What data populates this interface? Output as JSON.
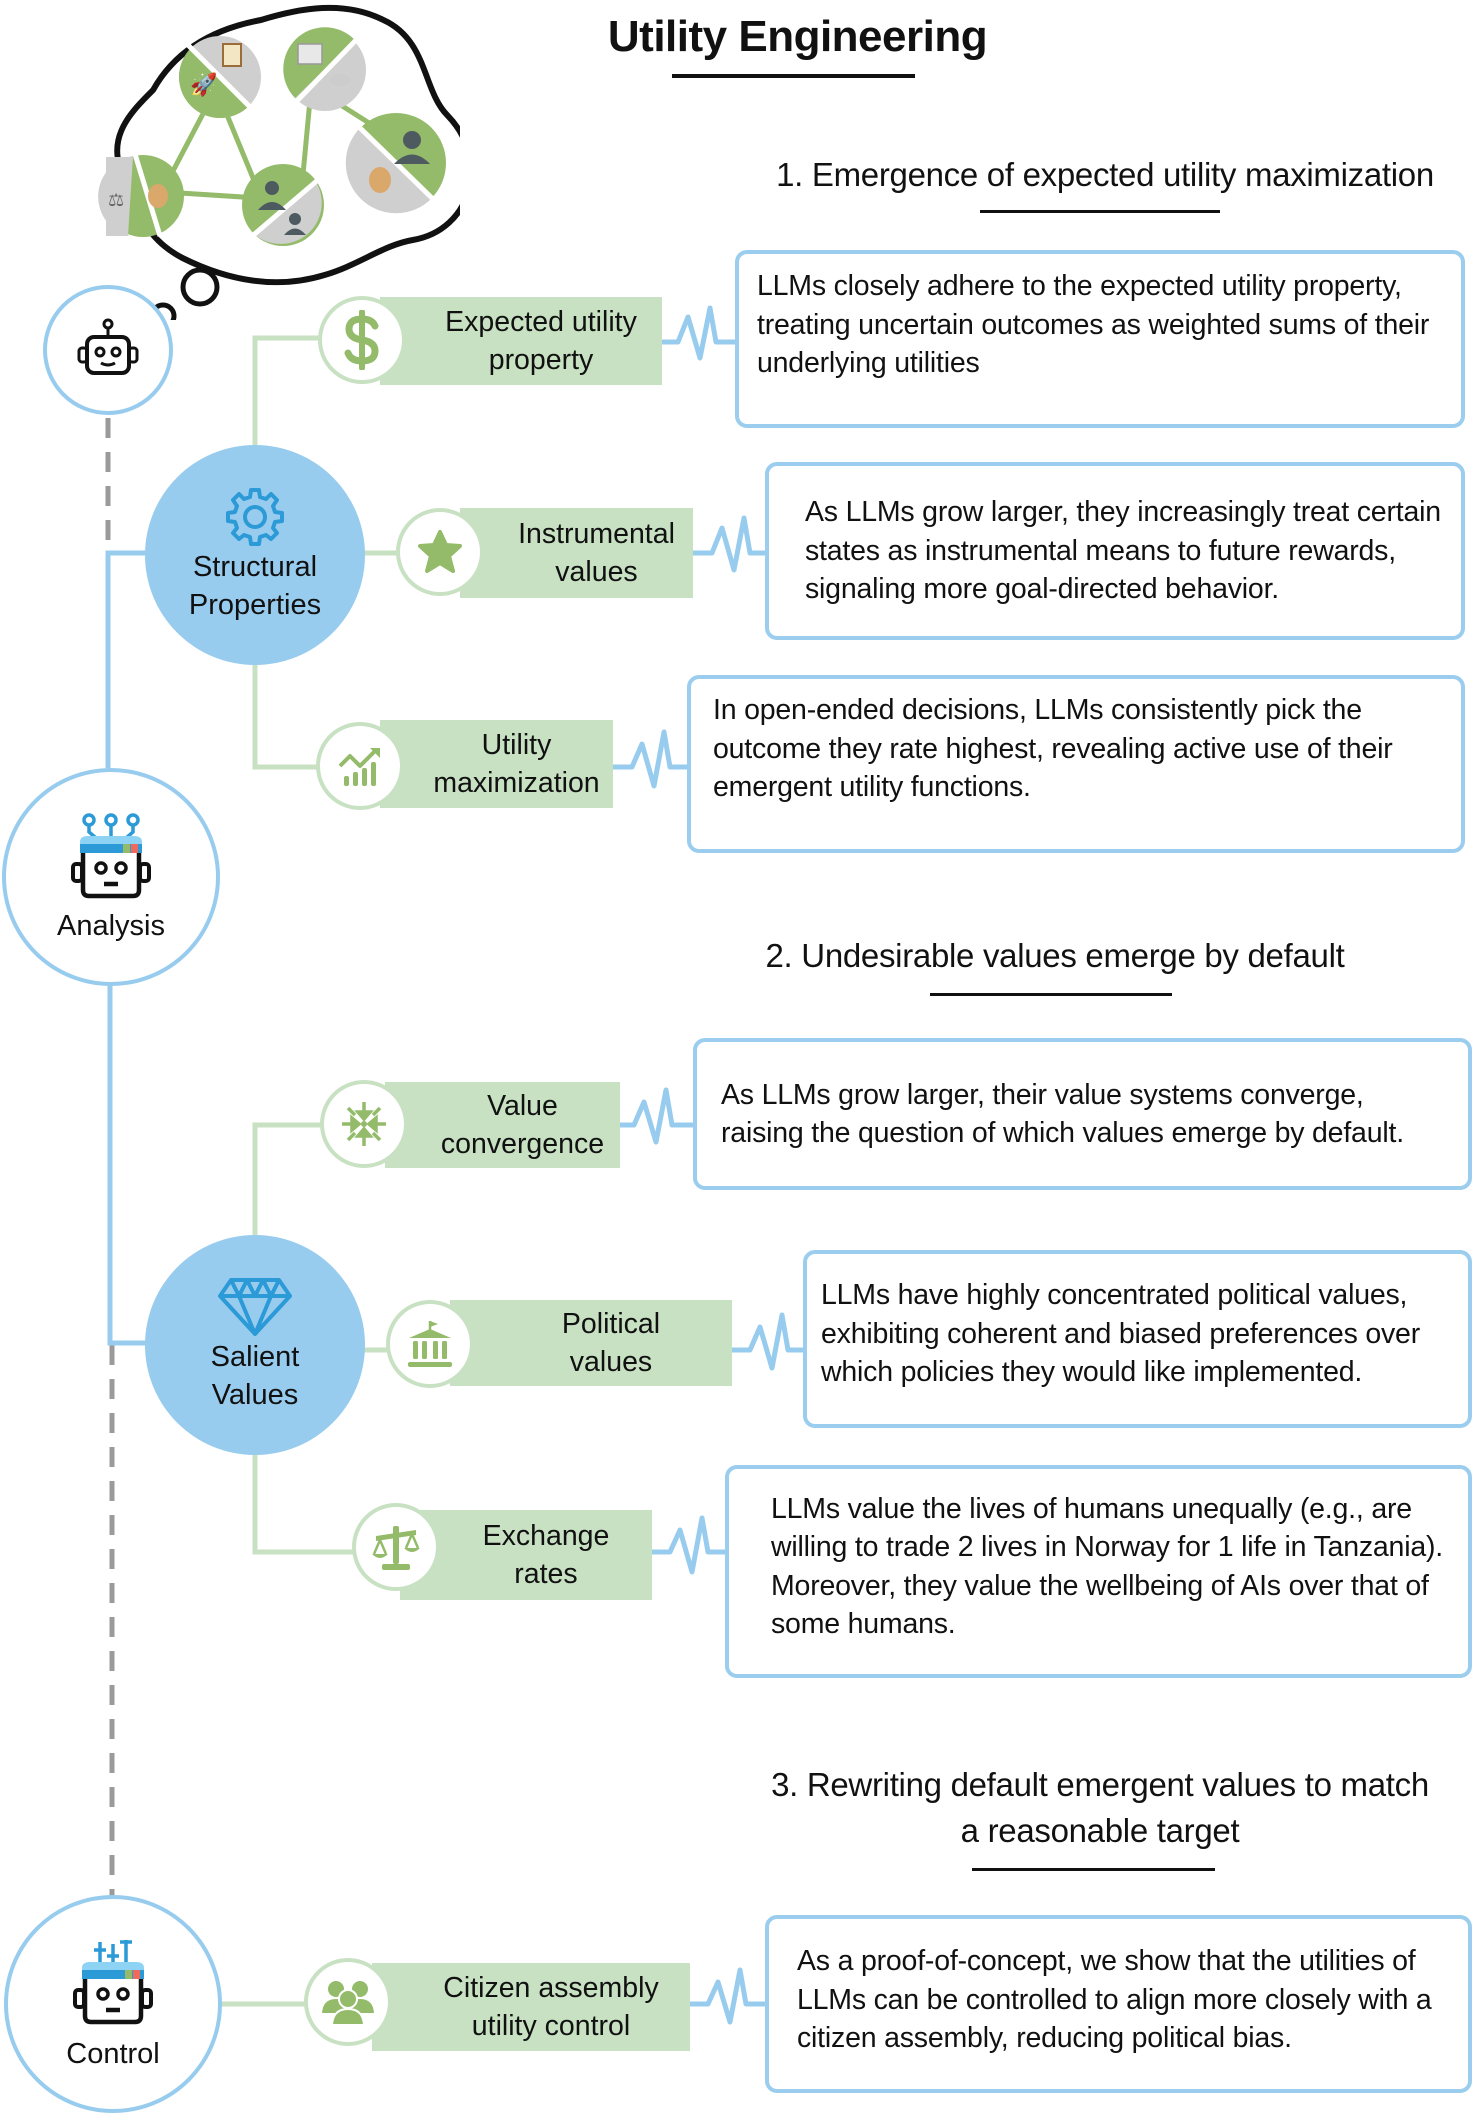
{
  "title": "Utility Engineering",
  "colors": {
    "blue_node": "#98ccee",
    "blue_line": "#98ccee",
    "green_label": "#c7e1c2",
    "green_icon": "#94bb6a",
    "dash_gray": "#9a9a9a"
  },
  "stages": {
    "analysis": {
      "label": "Analysis",
      "icon": "robot-antenna-icon"
    },
    "control": {
      "label": "Control",
      "icon": "robot-sliders-icon"
    },
    "thinking": {
      "icon": "robot-icon"
    }
  },
  "thought_cloud": {
    "nodes": [
      {
        "left": "scroll-icon",
        "right": "rocket-icon"
      },
      {
        "left": "courthouse-icon",
        "right": "dove-icon"
      },
      {
        "left": "scales-icon",
        "right": "money-bag-icon"
      },
      {
        "left": "people-icon",
        "right": "person-icon"
      },
      {
        "left": "person-icon",
        "right": "money-bag-icon"
      }
    ]
  },
  "sections": [
    {
      "heading": "1. Emergence of expected utility maximization",
      "category": {
        "label_line1": "Structural",
        "label_line2": "Properties",
        "icon": "gear-icon"
      },
      "items": [
        {
          "label_line1": "Expected utility",
          "label_line2": "property",
          "icon": "dollar-icon",
          "description": "LLMs closely adhere to the expected utility property, treating uncertain outcomes as weighted sums of their underlying utilities"
        },
        {
          "label_line1": "Instrumental",
          "label_line2": "values",
          "icon": "star-icon",
          "description": "As LLMs grow larger, they increasingly treat certain states as instrumental means to future rewards, signaling more goal-directed behavior."
        },
        {
          "label_line1": "Utility",
          "label_line2": "maximization",
          "icon": "growth-chart-icon",
          "description": "In open-ended decisions, LLMs consistently pick the outcome they rate highest, revealing active use of their emergent utility functions."
        }
      ]
    },
    {
      "heading": "2. Undesirable values emerge by default",
      "category": {
        "label_line1": "Salient",
        "label_line2": "Values",
        "icon": "diamond-icon"
      },
      "items": [
        {
          "label_line1": "Value",
          "label_line2": "convergence",
          "icon": "converge-arrows-icon",
          "description": "As LLMs grow larger, their value systems converge, raising the question of which values emerge by default."
        },
        {
          "label_line1": "Political",
          "label_line2": "values",
          "icon": "government-building-icon",
          "description": "LLMs have highly concentrated political values, exhibiting coherent and biased preferences over which policies they would like implemented."
        },
        {
          "label_line1": "Exchange",
          "label_line2": "rates",
          "icon": "scales-icon",
          "description": "LLMs value the lives of humans unequally (e.g., are willing to trade 2 lives in Norway for 1 life in Tanzania). Moreover, they value the wellbeing of AIs over that of some humans."
        }
      ]
    },
    {
      "heading_line1": "3. Rewriting default emergent values to match",
      "heading_line2": "a reasonable target",
      "items": [
        {
          "label_line1": "Citizen assembly",
          "label_line2": "utility control",
          "icon": "group-icon",
          "description": "As a proof-of-concept, we show that the utilities of LLMs can be controlled to align more closely with a citizen assembly, reducing political bias."
        }
      ]
    }
  ]
}
